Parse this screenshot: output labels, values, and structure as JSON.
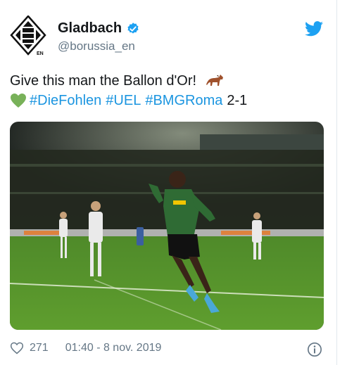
{
  "tweet": {
    "display_name": "Gladbach",
    "handle": "@borussia_en",
    "text_line1": "Give this man the Ballon d'Or!",
    "hashtags": [
      "#DieFohlen",
      "#UEL",
      "#BMGRoma"
    ],
    "score": "2-1",
    "likes": "271",
    "timestamp": "01:40 - 8 nov. 2019"
  },
  "icons": {
    "avatar": "borussia-crest-icon",
    "verified": "verified-badge-icon",
    "brand": "twitter-bird-icon",
    "emoji1": "horse-emoji-icon",
    "emoji2": "green-heart-emoji-icon",
    "like": "heart-outline-icon",
    "info": "info-icon"
  },
  "colors": {
    "link": "#1b95e0",
    "muted": "#657786",
    "brand": "#1da1f2",
    "verified": "#1da1f2"
  }
}
